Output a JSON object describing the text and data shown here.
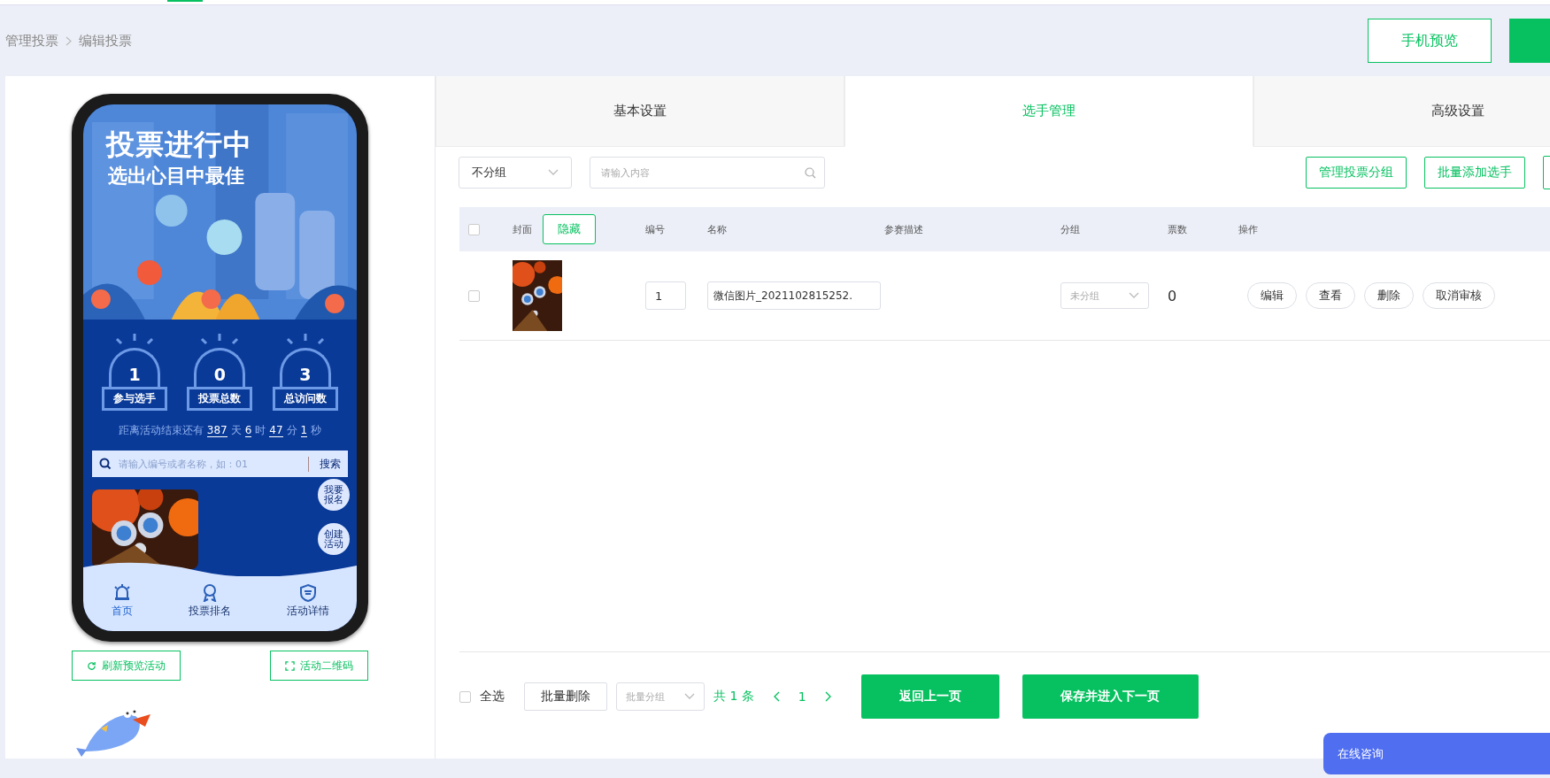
{
  "breadcrumb": [
    {
      "label": "管理投票"
    },
    {
      "label": "编辑投票"
    }
  ],
  "header_button": {
    "label": "手机预览"
  },
  "phone": {
    "banner_title": "投票进行中",
    "banner_subtitle": "选出心目中最佳",
    "stats": [
      {
        "value": "1",
        "label": "参与选手"
      },
      {
        "value": "0",
        "label": "投票总数"
      },
      {
        "value": "3",
        "label": "总访问数"
      }
    ],
    "countdown": {
      "prefix": "距离活动结束还有",
      "parts": [
        {
          "value": "387",
          "unit": "天"
        },
        {
          "value": "6",
          "unit": "时"
        },
        {
          "value": "47",
          "unit": "分"
        },
        {
          "value": "1",
          "unit": "秒"
        }
      ]
    },
    "search": {
      "placeholder": "请输入编号或者名称，如：01",
      "button": "搜索"
    },
    "floating_buttons": [
      {
        "label": "我要报名"
      },
      {
        "label": "创建活动"
      }
    ],
    "nav": [
      {
        "label": "首页",
        "selected": true
      },
      {
        "label": "投票排名",
        "selected": false
      },
      {
        "label": "活动详情",
        "selected": false
      }
    ]
  },
  "preview_buttons": [
    {
      "label": "刷新预览活动"
    },
    {
      "label": "活动二维码"
    }
  ],
  "tabs": [
    {
      "label": "基本设置",
      "selected": false
    },
    {
      "label": "选手管理",
      "selected": true
    },
    {
      "label": "高级设置",
      "selected": false
    }
  ],
  "toolbar": {
    "group_select": "不分组",
    "search_placeholder": "请输入内容",
    "buttons": [
      "管理投票分组",
      "批量添加选手"
    ]
  },
  "table": {
    "header_checked": false,
    "columns": [
      "封面",
      "编号",
      "名称",
      "参赛描述",
      "分组",
      "票数",
      "操作"
    ],
    "hide_button": "隐藏",
    "rows": [
      {
        "checked": false,
        "number": "1",
        "name": "微信图片_2021102815252.",
        "group_placeholder": "未分组",
        "votes": "0",
        "actions": [
          "编辑",
          "查看",
          "删除",
          "取消审核"
        ]
      }
    ]
  },
  "footer": {
    "select_all": {
      "label": "全选",
      "checked": false
    },
    "batch_delete": "批量删除",
    "batch_group_placeholder": "批量分组",
    "total": "共 1 条",
    "page": "1",
    "buttons": [
      "返回上一页",
      "保存并进入下一页"
    ]
  },
  "chat": {
    "label": "在线咨询"
  }
}
